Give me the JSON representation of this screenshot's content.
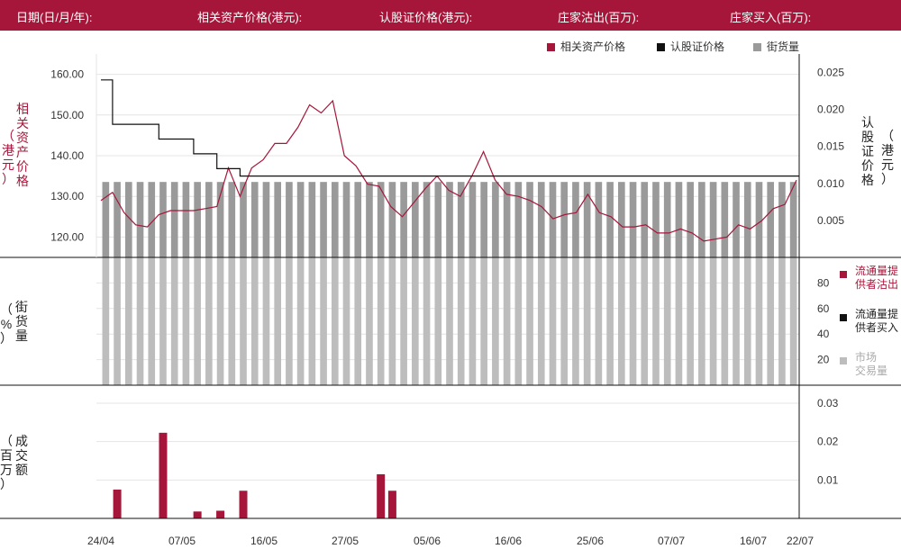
{
  "header": {
    "date_label": "日期(日/月/年):",
    "underlying_label": "相关资产价格(港元):",
    "warrant_label": "认股证价格(港元):",
    "sold_label": "庄家沽出(百万):",
    "bought_label": "庄家买入(百万):"
  },
  "legend": {
    "underlying": "相关资产价格",
    "warrant": "认股证价格",
    "outstanding": "街货量"
  },
  "axes": {
    "left_price_title": [
      "相",
      "关",
      "资",
      "产",
      "价",
      "格"
    ],
    "left_price_unit": [
      "（",
      "港",
      "元",
      "）"
    ],
    "right_price_title": [
      "认",
      "股",
      "证",
      "价",
      "格"
    ],
    "right_price_unit": [
      "（",
      "港",
      "元",
      "）"
    ],
    "mid_title": [
      "街",
      "货",
      "量"
    ],
    "mid_unit": [
      "%",
      "（",
      "）"
    ],
    "bottom_title": [
      "成",
      "交",
      "额"
    ],
    "bottom_unit": [
      "（",
      "百",
      "万",
      "）"
    ]
  },
  "right_legend": {
    "lp_sold": [
      "流通量提",
      "供者沽出"
    ],
    "lp_bought": [
      "流通量提",
      "供者买入"
    ],
    "market": [
      "市场",
      "交易量"
    ]
  },
  "colors": {
    "brand": "#a6163a",
    "underlying": "#a6163a",
    "warrant": "#111111",
    "outstanding_top": "#9a9a9a",
    "outstanding_mid": "#bdbdbd",
    "market": "#bdbdbd"
  },
  "chart_data": [
    {
      "type": "line",
      "name": "price",
      "x_tick_labels": [
        "24/04",
        "07/05",
        "16/05",
        "27/05",
        "05/06",
        "16/06",
        "25/06",
        "07/07",
        "16/07",
        "22/07"
      ],
      "left_ticks": [
        "120.00",
        "130.00",
        "140.00",
        "150.00",
        "160.00"
      ],
      "left_ylim": [
        115,
        165
      ],
      "right_ticks": [
        "0.005",
        "0.010",
        "0.015",
        "0.020",
        "0.025"
      ],
      "right_ylim": [
        0,
        0.0275
      ],
      "series": [
        {
          "name": "相关资产价格",
          "values": [
            129,
            131,
            126,
            123,
            122.5,
            125.5,
            126.5,
            126.5,
            126.5,
            127,
            127.5,
            137,
            130,
            137,
            139,
            143,
            143,
            147,
            152.5,
            150.5,
            153.5,
            140,
            137.5,
            133,
            132.5,
            127.5,
            125,
            128.5,
            132,
            135,
            131.5,
            130,
            135,
            141,
            134,
            130.5,
            130,
            129,
            127.5,
            124.5,
            125.5,
            126,
            130.5,
            126,
            125,
            122.5,
            122.5,
            123,
            121,
            121,
            122,
            121,
            119,
            119.5,
            120,
            123,
            122,
            124,
            127,
            128,
            134
          ]
        },
        {
          "name": "认股证价格",
          "values": [
            0.024,
            0.018,
            0.018,
            0.018,
            0.018,
            0.016,
            0.016,
            0.016,
            0.014,
            0.014,
            0.012,
            0.012,
            0.011,
            0.011
          ]
        }
      ],
      "outstanding_bars": 61
    },
    {
      "type": "bar",
      "name": "outstanding_pct",
      "right_ticks": [
        "20",
        "40",
        "60",
        "80"
      ],
      "ylim": [
        0,
        100
      ],
      "values": [
        100,
        100,
        100,
        100,
        100,
        100,
        100,
        100,
        100,
        100,
        100,
        100,
        100,
        100,
        100,
        100,
        100,
        100,
        100,
        100,
        100,
        100,
        100,
        100,
        100,
        100,
        100,
        100,
        100,
        100,
        100,
        100,
        100,
        100,
        100,
        100,
        100,
        100,
        100,
        100,
        100,
        100,
        100,
        100,
        100,
        100,
        100,
        100,
        100,
        100,
        100,
        100,
        100,
        100,
        100,
        100,
        100,
        100,
        100,
        100,
        100
      ]
    },
    {
      "type": "bar",
      "name": "turnover",
      "right_ticks": [
        "0.01",
        "0.02",
        "0.03"
      ],
      "ylim": [
        0,
        0.03
      ],
      "bars": [
        {
          "i": 1,
          "value": 0.0075
        },
        {
          "i": 5,
          "value": 0.0223
        },
        {
          "i": 8,
          "value": 0.0018
        },
        {
          "i": 10,
          "value": 0.002
        },
        {
          "i": 12,
          "value": 0.0072
        },
        {
          "i": 24,
          "value": 0.0115
        },
        {
          "i": 25,
          "value": 0.0072
        }
      ]
    }
  ]
}
